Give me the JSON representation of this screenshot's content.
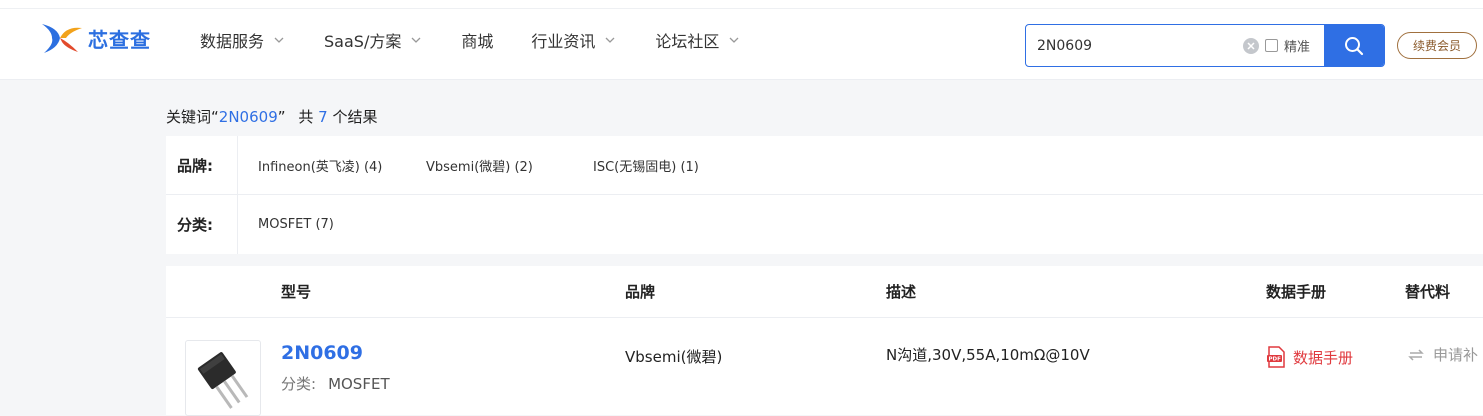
{
  "header": {
    "logo_text": "芯查查",
    "nav": [
      {
        "label": "数据服务",
        "has_dropdown": true
      },
      {
        "label": "SaaS/方案",
        "has_dropdown": true
      },
      {
        "label": "商城",
        "has_dropdown": false
      },
      {
        "label": "行业资讯",
        "has_dropdown": true
      },
      {
        "label": "论坛社区",
        "has_dropdown": true
      }
    ],
    "search": {
      "value": "2N0609",
      "exact_label": "精准",
      "exact_checked": false
    },
    "vip_label": "续费会员"
  },
  "summary": {
    "prefix": "关键词",
    "keyword": "2N0609",
    "mid": "共",
    "count": "7",
    "suffix": "个结果"
  },
  "filters": {
    "brand_label": "品牌:",
    "brands": [
      "Infineon(英飞凌) (4)",
      "Vbsemi(微碧) (2)",
      "ISC(无锡固电) (1)"
    ],
    "category_label": "分类:",
    "categories": [
      "MOSFET (7)"
    ]
  },
  "table": {
    "headers": {
      "model": "型号",
      "brand": "品牌",
      "desc": "描述",
      "datasheet": "数据手册",
      "alt": "替代料"
    },
    "rows": [
      {
        "model": "2N0609",
        "category_label": "分类:",
        "category": "MOSFET",
        "brand": "Vbsemi(微碧)",
        "description": "N沟道,30V,55A,10mΩ@10V",
        "datasheet_label": "数据手册",
        "alt_label": "申请补"
      }
    ]
  },
  "colors": {
    "accent": "#2f6fe4",
    "pdf": "#e0393e",
    "vip": "#8a5a2b"
  }
}
